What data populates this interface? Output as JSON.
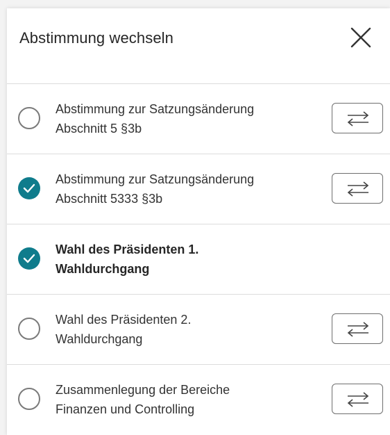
{
  "dialog": {
    "title": "Abstimmung wechseln",
    "close_icon": "close-icon"
  },
  "colors": {
    "accent": "#0f7c8c",
    "divider": "#dcdcdc",
    "text": "#333333"
  },
  "items": [
    {
      "line1": "Abstimmung zur Satzungsänderung",
      "line2": "Abschnitt 5 §3b",
      "selected": false,
      "bold": false,
      "switch_button": true,
      "switch_icon": "switch-arrows-icon"
    },
    {
      "line1": "Abstimmung zur Satzungsänderung",
      "line2": "Abschnitt 5333 §3b",
      "selected": true,
      "bold": false,
      "switch_button": true,
      "switch_icon": "switch-arrows-icon"
    },
    {
      "line1": "Wahl des Präsidenten 1.",
      "line2": "Wahldurchgang",
      "selected": true,
      "bold": true,
      "switch_button": false
    },
    {
      "line1": "Wahl des Präsidenten 2.",
      "line2": "Wahldurchgang",
      "selected": false,
      "bold": false,
      "switch_button": true,
      "switch_icon": "switch-arrows-icon"
    },
    {
      "line1": "Zusammenlegung der Bereiche",
      "line2": "Finanzen und Controlling",
      "selected": false,
      "bold": false,
      "switch_button": true,
      "switch_icon": "switch-arrows-icon"
    }
  ]
}
